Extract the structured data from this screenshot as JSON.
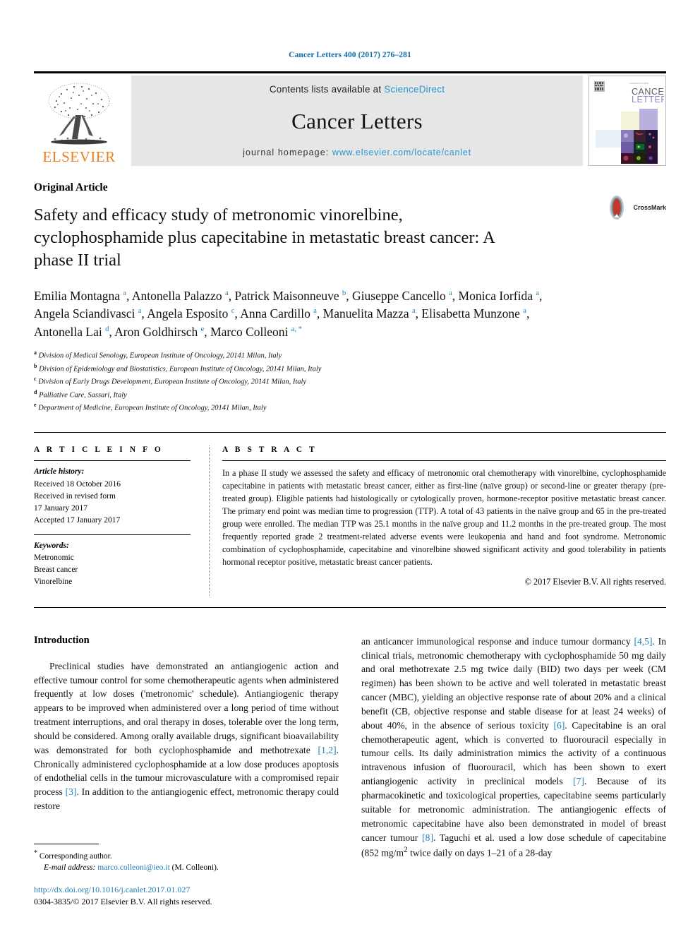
{
  "running_head": "Cancer Letters 400 (2017) 276–281",
  "masthead": {
    "publisher_logo_name": "elsevier-tree-logo",
    "publisher_wordmark": "ELSEVIER",
    "contents_prefix": "Contents lists available at ",
    "contents_link": "ScienceDirect",
    "journal_name": "Cancer Letters",
    "homepage_prefix": "journal homepage: ",
    "homepage_url": "www.elsevier.com/locate/canlet",
    "cover_title_line1": "CANCER",
    "cover_title_line2": "LETTERS"
  },
  "article": {
    "type": "Original Article",
    "title": "Safety and efficacy study of metronomic vinorelbine, cyclophosphamide plus capecitabine in metastatic breast cancer: A phase II trial",
    "crossmark_label": "CrossMark",
    "authors_html": "Emilia Montagna <sup>a</sup>, Antonella Palazzo <sup>a</sup>, Patrick Maisonneuve <sup>b</sup>, Giuseppe Cancello <sup>a</sup>, Monica Iorfida <sup>a</sup>, Angela Sciandivasci <sup>a</sup>, Angela Esposito <sup>c</sup>, Anna Cardillo <sup>a</sup>, Manuelita Mazza <sup>a</sup>, Elisabetta Munzone <sup>a</sup>, Antonella Lai <sup>d</sup>, Aron Goldhirsch <sup>e</sup>, Marco Colleoni <sup>a, *</sup>",
    "affiliations": [
      {
        "marker": "a",
        "text": "Division of Medical Senology, European Institute of Oncology, 20141 Milan, Italy"
      },
      {
        "marker": "b",
        "text": "Division of Epidemiology and Biostatistics, European Institute of Oncology, 20141 Milan, Italy"
      },
      {
        "marker": "c",
        "text": "Division of Early Drugs Development, European Institute of Oncology, 20141 Milan, Italy"
      },
      {
        "marker": "d",
        "text": "Palliative Care, Sassari, Italy"
      },
      {
        "marker": "e",
        "text": "Department of Medicine, European Institute of Oncology, 20141 Milan, Italy"
      }
    ]
  },
  "article_info": {
    "heading": "A R T I C L E   I N F O",
    "history_label": "Article history:",
    "history": [
      "Received 18 October 2016",
      "Received in revised form",
      "17 January 2017",
      "Accepted 17 January 2017"
    ],
    "keywords_label": "Keywords:",
    "keywords": [
      "Metronomic",
      "Breast cancer",
      "Vinorelbine"
    ]
  },
  "abstract": {
    "heading": "A B S T R A C T",
    "text": "In a phase II study we assessed the safety and efficacy of metronomic oral chemotherapy with vinorelbine, cyclophosphamide capecitabine in patients with metastatic breast cancer, either as first-line (naïve group) or second-line or greater therapy (pre-treated group). Eligible patients had histologically or cytologically proven, hormone-receptor positive metastatic breast cancer. The primary end point was median time to progression (TTP). A total of 43 patients in the naïve group and 65 in the pre-treated group were enrolled. The median TTP was 25.1 months in the naïve group and 11.2 months in the pre-treated group. The most frequently reported grade 2 treatment-related adverse events were leukopenia and hand and foot syndrome. Metronomic combination of cyclophosphamide, capecitabine and vinorelbine showed significant activity and good tolerability in patients hormonal receptor positive, metastatic breast cancer patients.",
    "copyright": "© 2017 Elsevier B.V. All rights reserved."
  },
  "introduction": {
    "heading": "Introduction",
    "left_paragraph_html": "Preclinical studies have demonstrated an antiangiogenic action and effective tumour control for some chemotherapeutic agents when administered frequently at low doses ('metronomic' schedule). Antiangiogenic therapy appears to be improved when administered over a long period of time without treatment interruptions, and oral therapy in doses, tolerable over the long term, should be considered. Among orally available drugs, significant bioavailability was demonstrated for both cyclophosphamide and methotrexate <span class=\"ref\">[1,2]</span>. Chronically administered cyclophosphamide at a low dose produces apoptosis of endothelial cells in the tumour microvasculature with a compromised repair process <span class=\"ref\">[3]</span>. In addition to the antiangiogenic effect, metronomic therapy could restore",
    "right_paragraph_html": "an anticancer immunological response and induce tumour dormancy <span class=\"ref\">[4,5]</span>. In clinical trials, metronomic chemotherapy with cyclophosphamide 50 mg daily and oral methotrexate 2.5 mg twice daily (BID) two days per week (CM regimen) has been shown to be active and well tolerated in metastatic breast cancer (MBC), yielding an objective response rate of about 20% and a clinical benefit (CB, objective response and stable disease for at least 24 weeks) of about 40%, in the absence of serious toxicity <span class=\"ref\">[6]</span>. Capecitabine is an oral chemotherapeutic agent, which is converted to fluorouracil especially in tumour cells. Its daily administration mimics the activity of a continuous intravenous infusion of fluorouracil, which has been shown to exert antiangiogenic activity in preclinical models <span class=\"ref\">[7]</span>. Because of its pharmacokinetic and toxicological properties, capecitabine seems particularly suitable for metronomic administration. The antiangiogenic effects of metronomic capecitabine have also been demonstrated in model of breast cancer tumour <span class=\"ref\">[8]</span>. Taguchi et al. used a low dose schedule of capecitabine (852 mg/m<sup>2</sup> twice daily on days 1–21 of a 28-day"
  },
  "footnote": {
    "corresponding_marker": "*",
    "corresponding_text": "Corresponding author.",
    "email_label": "E-mail address:",
    "email": "marco.colleoni@ieo.it",
    "email_suffix": "(M. Colleoni).",
    "doi": "http://dx.doi.org/10.1016/j.canlet.2017.01.027",
    "issn_line": "0304-3835/© 2017 Elsevier B.V. All rights reserved."
  },
  "colors": {
    "link_blue": "#1f7fb8",
    "sciencedirect_blue": "#2596d1",
    "elsevier_orange": "#ee7f1a",
    "masthead_gray": "#e6e6e6"
  }
}
